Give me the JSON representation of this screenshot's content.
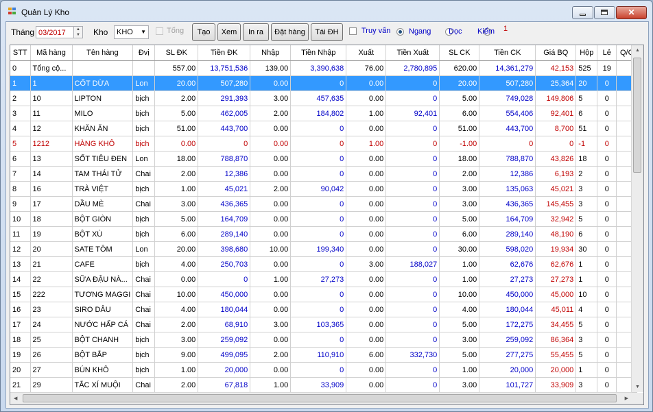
{
  "window": {
    "title": "Quản Lý Kho"
  },
  "toolbar": {
    "month_label": "Tháng",
    "month_value": "03/2017",
    "kho_label": "Kho",
    "kho_value": "KHO",
    "tong_label": "Tổng",
    "tao_label": "Tạo",
    "xem_label": "Xem",
    "inra_label": "In ra",
    "dathang_label": "Đặt hàng",
    "taidh_label": "Tái ĐH",
    "truyvan_label": "Truy vấn",
    "ngang_label": "Ngang",
    "doc_label": "Dọc",
    "kiem_label": "Kiểm",
    "counter": "1"
  },
  "colors": {
    "accent_blue": "#0000c8",
    "price_red": "#c00000",
    "selection": "#3399ff"
  },
  "grid": {
    "columns": [
      "STT",
      "Mã hàng",
      "Tên hàng",
      "Đvị",
      "SL ĐK",
      "Tiền ĐK",
      "Nhập",
      "Tiền Nhập",
      "Xuất",
      "Tiền Xuất",
      "SL CK",
      "Tiền CK",
      "Giá BQ",
      "Hộp",
      "Lẻ",
      "Q/C"
    ],
    "rows": [
      [
        "0",
        "Tổng cộ...",
        "",
        "",
        "557.00",
        "13,751,536",
        "139.00",
        "3,390,638",
        "76.00",
        "2,780,895",
        "620.00",
        "14,361,279",
        "42,153",
        "525",
        "19",
        ""
      ],
      [
        "1",
        "1",
        "CỐT DỪA",
        "Lon",
        "20.00",
        "507,280",
        "0.00",
        "0",
        "0.00",
        "0",
        "20.00",
        "507,280",
        "25,364",
        "20",
        "0",
        ""
      ],
      [
        "2",
        "10",
        "LIPTON",
        "bịch",
        "2.00",
        "291,393",
        "3.00",
        "457,635",
        "0.00",
        "0",
        "5.00",
        "749,028",
        "149,806",
        "5",
        "0",
        ""
      ],
      [
        "3",
        "11",
        "MILO",
        "bịch",
        "5.00",
        "462,005",
        "2.00",
        "184,802",
        "1.00",
        "92,401",
        "6.00",
        "554,406",
        "92,401",
        "6",
        "0",
        ""
      ],
      [
        "4",
        "12",
        "KHĂN ĂN",
        "bịch",
        "51.00",
        "443,700",
        "0.00",
        "0",
        "0.00",
        "0",
        "51.00",
        "443,700",
        "8,700",
        "51",
        "0",
        ""
      ],
      [
        "5",
        "1212",
        "HÀNG KHÔ",
        "bịch",
        "0.00",
        "0",
        "0.00",
        "0",
        "1.00",
        "0",
        "-1.00",
        "0",
        "0",
        "-1",
        "0",
        ""
      ],
      [
        "6",
        "13",
        "SỐT TIÊU ĐEN",
        "Lon",
        "18.00",
        "788,870",
        "0.00",
        "0",
        "0.00",
        "0",
        "18.00",
        "788,870",
        "43,826",
        "18",
        "0",
        ""
      ],
      [
        "7",
        "14",
        "TAM THÁI TỬ",
        "Chai",
        "2.00",
        "12,386",
        "0.00",
        "0",
        "0.00",
        "0",
        "2.00",
        "12,386",
        "6,193",
        "2",
        "0",
        ""
      ],
      [
        "8",
        "16",
        "TRÀ VIỆT",
        "bịch",
        "1.00",
        "45,021",
        "2.00",
        "90,042",
        "0.00",
        "0",
        "3.00",
        "135,063",
        "45,021",
        "3",
        "0",
        ""
      ],
      [
        "9",
        "17",
        "DẦU MÈ",
        "Chai",
        "3.00",
        "436,365",
        "0.00",
        "0",
        "0.00",
        "0",
        "3.00",
        "436,365",
        "145,455",
        "3",
        "0",
        ""
      ],
      [
        "10",
        "18",
        "BỘT GIÒN",
        "bịch",
        "5.00",
        "164,709",
        "0.00",
        "0",
        "0.00",
        "0",
        "5.00",
        "164,709",
        "32,942",
        "5",
        "0",
        ""
      ],
      [
        "11",
        "19",
        "BỘT XÙ",
        "bịch",
        "6.00",
        "289,140",
        "0.00",
        "0",
        "0.00",
        "0",
        "6.00",
        "289,140",
        "48,190",
        "6",
        "0",
        ""
      ],
      [
        "12",
        "20",
        "SATE TÔM",
        "Lon",
        "20.00",
        "398,680",
        "10.00",
        "199,340",
        "0.00",
        "0",
        "30.00",
        "598,020",
        "19,934",
        "30",
        "0",
        ""
      ],
      [
        "13",
        "21",
        "CAFE",
        "bịch",
        "4.00",
        "250,703",
        "0.00",
        "0",
        "3.00",
        "188,027",
        "1.00",
        "62,676",
        "62,676",
        "1",
        "0",
        ""
      ],
      [
        "14",
        "22",
        "SỮA ĐẬU NÀ...",
        "Chai",
        "0.00",
        "0",
        "1.00",
        "27,273",
        "0.00",
        "0",
        "1.00",
        "27,273",
        "27,273",
        "1",
        "0",
        ""
      ],
      [
        "15",
        "222",
        "TƯƠNG MAGGI",
        "Chai",
        "10.00",
        "450,000",
        "0.00",
        "0",
        "0.00",
        "0",
        "10.00",
        "450,000",
        "45,000",
        "10",
        "0",
        ""
      ],
      [
        "16",
        "23",
        "SIRO DÂU",
        "Chai",
        "4.00",
        "180,044",
        "0.00",
        "0",
        "0.00",
        "0",
        "4.00",
        "180,044",
        "45,011",
        "4",
        "0",
        ""
      ],
      [
        "17",
        "24",
        "NƯỚC HẤP CÁ",
        "Chai",
        "2.00",
        "68,910",
        "3.00",
        "103,365",
        "0.00",
        "0",
        "5.00",
        "172,275",
        "34,455",
        "5",
        "0",
        ""
      ],
      [
        "18",
        "25",
        "BỘT CHANH",
        "bịch",
        "3.00",
        "259,092",
        "0.00",
        "0",
        "0.00",
        "0",
        "3.00",
        "259,092",
        "86,364",
        "3",
        "0",
        ""
      ],
      [
        "19",
        "26",
        "BỘT BẮP",
        "bịch",
        "9.00",
        "499,095",
        "2.00",
        "110,910",
        "6.00",
        "332,730",
        "5.00",
        "277,275",
        "55,455",
        "5",
        "0",
        ""
      ],
      [
        "20",
        "27",
        "BÚN KHÔ",
        "bịch",
        "1.00",
        "20,000",
        "0.00",
        "0",
        "0.00",
        "0",
        "1.00",
        "20,000",
        "20,000",
        "1",
        "0",
        ""
      ],
      [
        "21",
        "29",
        "TẮC XÍ MUỘI",
        "Chai",
        "2.00",
        "67,818",
        "1.00",
        "33,909",
        "0.00",
        "0",
        "3.00",
        "101,727",
        "33,909",
        "3",
        "0",
        ""
      ]
    ]
  }
}
